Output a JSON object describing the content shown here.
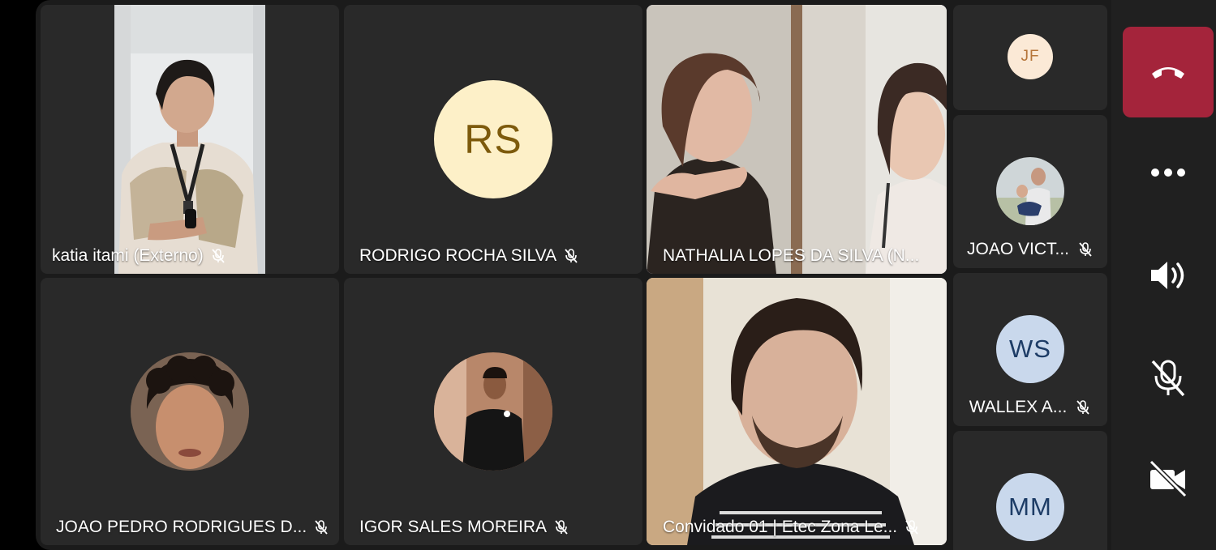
{
  "participants": {
    "p1": {
      "name": "katia itami (Externo)"
    },
    "p2": {
      "name": "RODRIGO ROCHA SILVA",
      "initials": "RS"
    },
    "p3": {
      "name": "NATHALIA LOPES DA SILVA (N..."
    },
    "p4": {
      "name": "JOAO PEDRO RODRIGUES D..."
    },
    "p5": {
      "name": "IGOR SALES MOREIRA"
    },
    "p6": {
      "name": "Convidado 01 | Etec Zona Le..."
    }
  },
  "side_participants": {
    "jf": {
      "initials": "JF"
    },
    "jv": {
      "name": "JOAO VICT..."
    },
    "ws": {
      "initials": "WS",
      "name": "WALLEX A..."
    },
    "mm": {
      "initials": "MM"
    }
  },
  "colors": {
    "end_call": "#a4243b",
    "active_speaker_outline": "#7f85f5",
    "avatar_rs_bg": "#fdf0c8",
    "avatar_rs_fg": "#7d5a0c",
    "avatar_blue_bg": "#c9d8ec",
    "avatar_blue_fg": "#1d3c66"
  },
  "controls": [
    "end-call-icon",
    "more-options-icon",
    "speaker-icon",
    "mic-off-icon",
    "camera-off-icon"
  ]
}
